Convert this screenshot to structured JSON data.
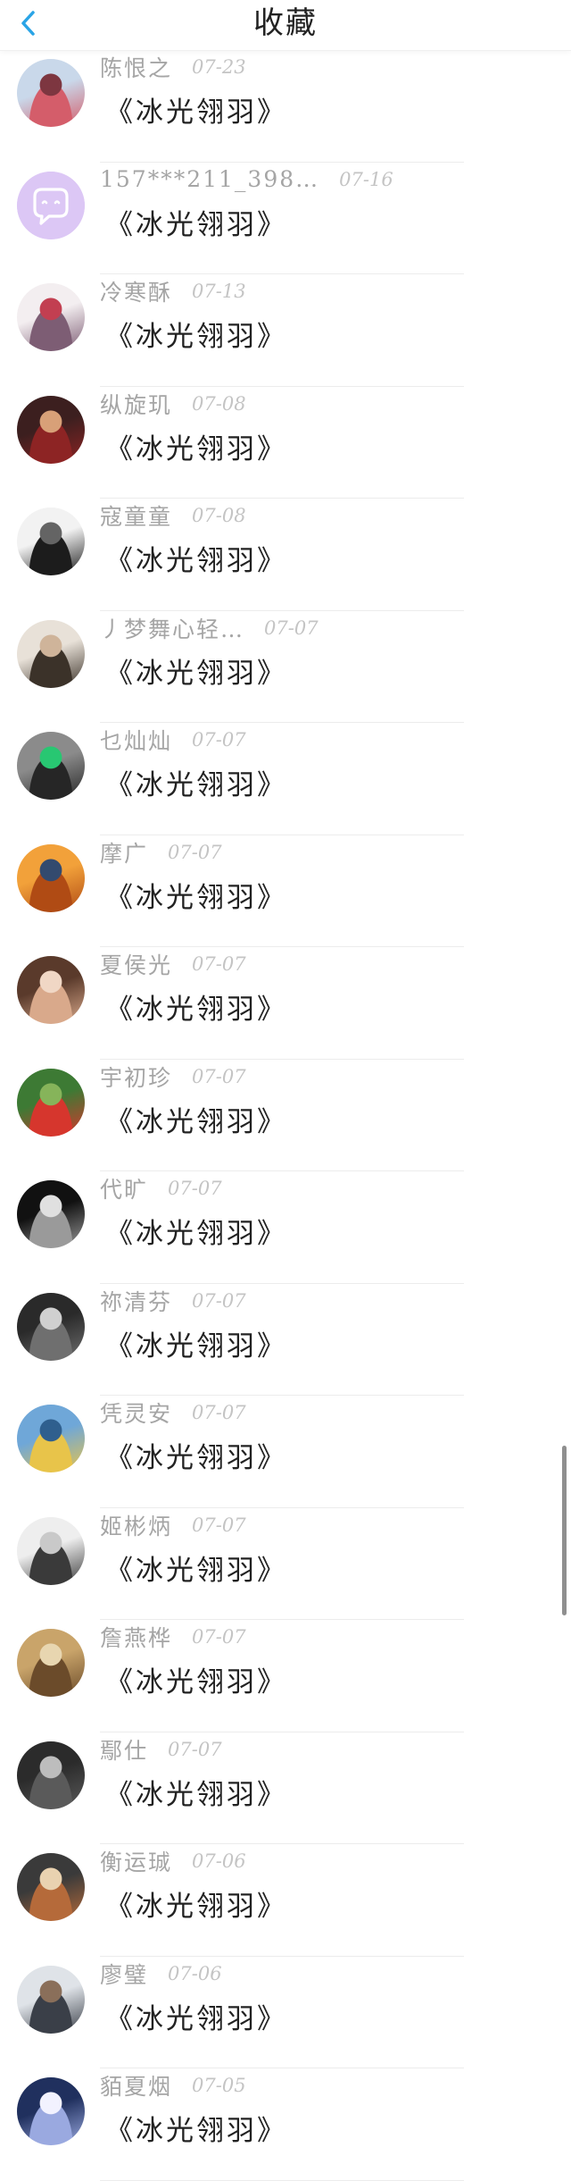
{
  "header": {
    "title": "收藏",
    "back_icon": "chevron-left-icon",
    "accent": "#2aa4e6"
  },
  "items": [
    {
      "sender": "陈恨之",
      "date": "07-23",
      "title": "《冰光翎羽》",
      "avatar": "avatar-1",
      "colors": [
        "#c9d8ea",
        "#d45d6a",
        "#7d3640"
      ]
    },
    {
      "sender": "157***211_398…",
      "date": "07-16",
      "title": "《冰光翎羽》",
      "avatar": "chat-bubble-avatar",
      "colors": [
        "#dcc7f5",
        "#b58ae8",
        "#ffffff"
      ]
    },
    {
      "sender": "冷寒酥",
      "date": "07-13",
      "title": "《冰光翎羽》",
      "avatar": "avatar-3",
      "colors": [
        "#f3eef0",
        "#7d5d74",
        "#c23f51"
      ]
    },
    {
      "sender": "纵旋玑",
      "date": "07-08",
      "title": "《冰光翎羽》",
      "avatar": "avatar-4",
      "colors": [
        "#3c1f1f",
        "#8d2424",
        "#d8a078"
      ]
    },
    {
      "sender": "寇童童",
      "date": "07-08",
      "title": "《冰光翎羽》",
      "avatar": "avatar-5",
      "colors": [
        "#f2f2f2",
        "#1c1c1c",
        "#646464"
      ]
    },
    {
      "sender": "丿梦舞心轻…",
      "date": "07-07",
      "title": "《冰光翎羽》",
      "avatar": "avatar-6",
      "colors": [
        "#e8e1d8",
        "#3b3229",
        "#cfb49a"
      ]
    },
    {
      "sender": "乜灿灿",
      "date": "07-07",
      "title": "《冰光翎羽》",
      "avatar": "avatar-7",
      "colors": [
        "#8b8b8b",
        "#262626",
        "#28c772"
      ]
    },
    {
      "sender": "摩广",
      "date": "07-07",
      "title": "《冰光翎羽》",
      "avatar": "avatar-8",
      "colors": [
        "#f2a13a",
        "#b04b14",
        "#334a6e"
      ]
    },
    {
      "sender": "夏侯光",
      "date": "07-07",
      "title": "《冰光翎羽》",
      "avatar": "avatar-9",
      "colors": [
        "#5a3a2b",
        "#d9a98b",
        "#f0d7c5"
      ]
    },
    {
      "sender": "宇初珍",
      "date": "07-07",
      "title": "《冰光翎羽》",
      "avatar": "avatar-10",
      "colors": [
        "#3d7a34",
        "#d6362d",
        "#86b45a"
      ]
    },
    {
      "sender": "代旷",
      "date": "07-07",
      "title": "《冰光翎羽》",
      "avatar": "avatar-11",
      "colors": [
        "#111111",
        "#9a9a9a",
        "#e0e0e0"
      ]
    },
    {
      "sender": "祢清芬",
      "date": "07-07",
      "title": "《冰光翎羽》",
      "avatar": "avatar-12",
      "colors": [
        "#2a2a2a",
        "#6f6f6f",
        "#d0d0d0"
      ]
    },
    {
      "sender": "凭灵安",
      "date": "07-07",
      "title": "《冰光翎羽》",
      "avatar": "avatar-13",
      "colors": [
        "#6fa7d8",
        "#e8c44a",
        "#2f5f8e"
      ]
    },
    {
      "sender": "姬彬炳",
      "date": "07-07",
      "title": "《冰光翎羽》",
      "avatar": "avatar-14",
      "colors": [
        "#eeeeee",
        "#3a3a3a",
        "#c9c9c9"
      ]
    },
    {
      "sender": "詹燕桦",
      "date": "07-07",
      "title": "《冰光翎羽》",
      "avatar": "avatar-15",
      "colors": [
        "#c9a46a",
        "#6b4b2a",
        "#e8d6b0"
      ]
    },
    {
      "sender": "鄢仕",
      "date": "07-07",
      "title": "《冰光翎羽》",
      "avatar": "avatar-16",
      "colors": [
        "#2b2b2b",
        "#5a5a5a",
        "#bdbdbd"
      ]
    },
    {
      "sender": "衡运珹",
      "date": "07-06",
      "title": "《冰光翎羽》",
      "avatar": "avatar-17",
      "colors": [
        "#3a3a3a",
        "#b56a3a",
        "#e9d2b0"
      ]
    },
    {
      "sender": "廖璧",
      "date": "07-06",
      "title": "《冰光翎羽》",
      "avatar": "avatar-18",
      "colors": [
        "#dfe3e8",
        "#3a3f48",
        "#8a6f5a"
      ]
    },
    {
      "sender": "貊夏烟",
      "date": "07-05",
      "title": "《冰光翎羽》",
      "avatar": "avatar-19",
      "colors": [
        "#20305e",
        "#9aa9e0",
        "#f2f2ff"
      ]
    }
  ]
}
